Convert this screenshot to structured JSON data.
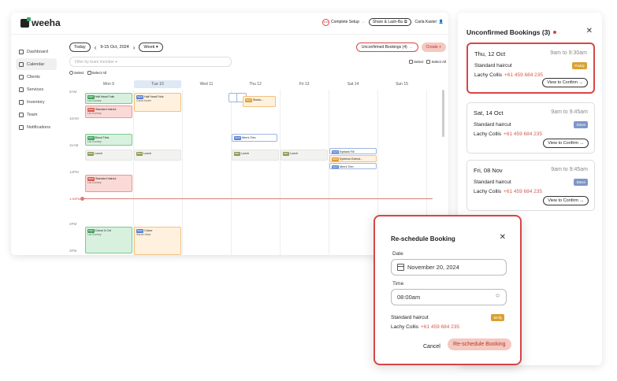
{
  "app": {
    "logo": "weeha"
  },
  "topbar": {
    "setup_pct": "40%",
    "setup_label": "Complete Setup",
    "setup_arrow": "→",
    "share_label": "Share & Lash-Ba",
    "user_name": "Carla Kastel"
  },
  "sidebar": {
    "items": [
      {
        "label": "Dashboard"
      },
      {
        "label": "Calendar"
      },
      {
        "label": "Clients"
      },
      {
        "label": "Services"
      },
      {
        "label": "Inventory"
      },
      {
        "label": "Team"
      },
      {
        "label": "Notifications"
      }
    ]
  },
  "toolbar": {
    "today": "Today",
    "range": "9-15 Oct, 2024",
    "view": "Week ▾",
    "unconfirmed": "Unconfirmed Bookings (4)",
    "create": "Create +",
    "filter_placeholder": "Filter by team member ▾",
    "select": "Select",
    "select_all": "Select All"
  },
  "calendar": {
    "days": [
      "Mon 9",
      "Tue 10",
      "Wed 11",
      "Thu 12",
      "Fri 13",
      "Sat 14",
      "Sun 15"
    ],
    "times": [
      "9AM",
      "10AM",
      "11AM",
      "12PM",
      "1PM",
      "2PM",
      "3PM"
    ],
    "now_label": "1:30PM",
    "events": {
      "e1": {
        "tag": "PRO",
        "title": "Half Head Foils",
        "sub": "Lia Gurney"
      },
      "e2": {
        "tag": "NEW",
        "title": "Half Head Foils",
        "sub": "Carla Kurtel"
      },
      "e3": {
        "tag": "NEW",
        "title": "Standard haircut",
        "sub": "Lia Gurney"
      },
      "e4": {
        "tag": "NEW",
        "title": "Shedu...",
        "sub": ""
      },
      "e5": {
        "tag": "PRO",
        "title": "Blood Tints",
        "sub": "Lia Gurney"
      },
      "e6": {
        "tag": "NEW",
        "title": "Men's Trim",
        "sub": ""
      },
      "e7": {
        "tag": "BRK",
        "title": "Lunch",
        "sub": ""
      },
      "e8": {
        "tag": "BRK",
        "title": "Lunch",
        "sub": ""
      },
      "e9": {
        "tag": "BRK",
        "title": "Lunch",
        "sub": ""
      },
      "e10": {
        "tag": "BRK",
        "title": "Lunch",
        "sub": ""
      },
      "e11": {
        "tag": "NEW",
        "title": "Eyelash Fill",
        "sub": ""
      },
      "e12": {
        "tag": "NEW",
        "title": "Eyebrow Extend...",
        "sub": ""
      },
      "e13": {
        "tag": "NEW",
        "title": "Men's Trim",
        "sub": ""
      },
      "e14": {
        "tag": "NEW",
        "title": "Standard haircut",
        "sub": "Lia Gurney"
      },
      "e15": {
        "tag": "PRO",
        "title": "Colour & Cut",
        "sub": "Lia Gurney"
      },
      "e16": {
        "tag": "NEW",
        "title": "Colour",
        "sub": "Sarah Maw"
      }
    }
  },
  "panel": {
    "title": "Unconfirmed Bookings (3)",
    "cards": [
      {
        "date": "Thu, 12 Oct",
        "time": "9am to 9:30am",
        "service": "Standard haircut",
        "badge": "Paddy",
        "badge_color": "#d9a032",
        "client": "Lachy Collis",
        "phone": "+61 459 684 235",
        "button": "View to Confirm →"
      },
      {
        "date": "Sat, 14 Oct",
        "time": "9am to 9:45am",
        "service": "Standard haircut",
        "badge": "Steve",
        "badge_color": "#7e97c8",
        "client": "Lachy Collis",
        "phone": "+61 459 684 235",
        "button": "View to Confirm →"
      },
      {
        "date": "Fri, 08 Nov",
        "time": "9am to 9:45am",
        "service": "Standard haircut",
        "badge": "Steve",
        "badge_color": "#7e97c8",
        "client": "Lachy Collis",
        "phone": "+61 459 684 235",
        "button": "View to Confirm →"
      }
    ]
  },
  "modal": {
    "title": "Re-schedule Booking",
    "date_label": "Date",
    "date_value": "November 20, 2024",
    "time_label": "Time",
    "time_value": "08:00am",
    "service": "Standard haircut",
    "badge": "Molly",
    "client": "Lachy Collis",
    "phone": "+61 459 684 235",
    "cancel": "Cancel",
    "confirm": "Re-schedule Booking"
  },
  "colors": {
    "accent": "#d94545",
    "cta_bg": "#f5c8c0"
  }
}
